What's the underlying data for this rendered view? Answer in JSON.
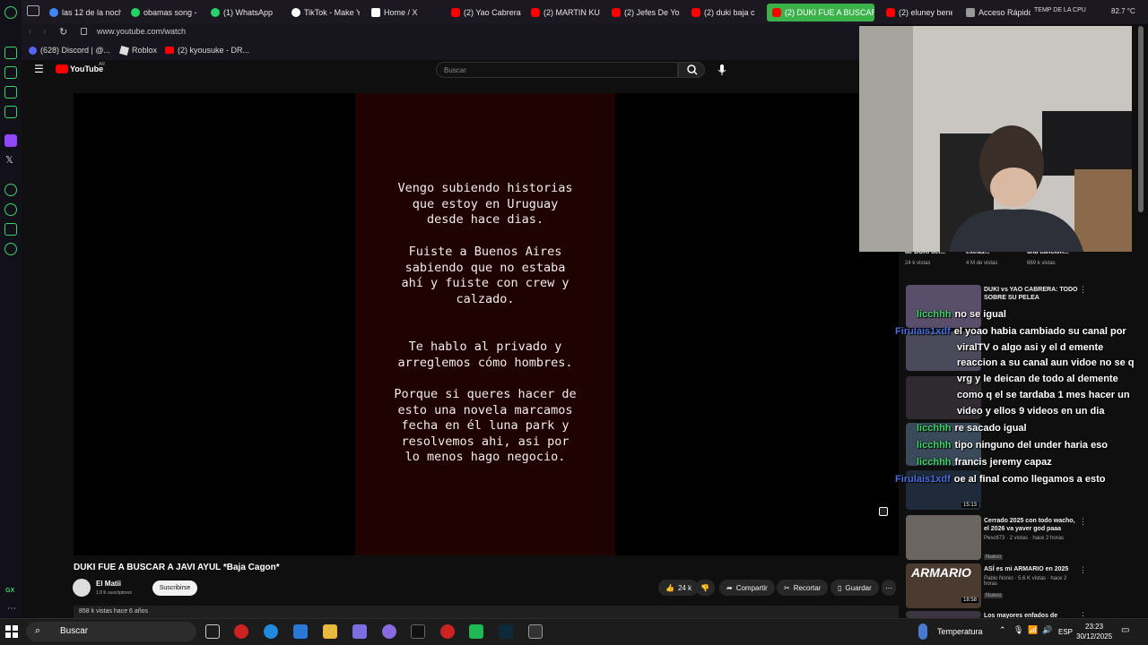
{
  "browser": {
    "tabs": [
      {
        "label": "las 12 de la noch",
        "color": "#4285f4"
      },
      {
        "label": "obamas song -",
        "color": "#1ed760"
      },
      {
        "label": "(1) WhatsApp",
        "color": "#25d366"
      },
      {
        "label": "TikTok - Make Y",
        "color": "#ffffff"
      },
      {
        "label": "Home / X",
        "color": "#ffffff"
      },
      {
        "label": "(2) Yao Cabrera",
        "color": "#ff0000"
      },
      {
        "label": "(2) MARTIN KU",
        "color": "#ff0000"
      },
      {
        "label": "(2) Jefes De Yo",
        "color": "#ff0000"
      },
      {
        "label": "(2) duki baja c",
        "color": "#ff0000"
      },
      {
        "label": "(2) DUKI FUE A BUSCAR",
        "color": "#ff0000",
        "active": true
      },
      {
        "label": "(2) eluney bene",
        "color": "#ff0000"
      },
      {
        "label": "Acceso Rápido",
        "color": "#999999"
      }
    ],
    "hw_label": "TEMP DE LA CPU",
    "hw_value": "82.7 °C",
    "url": "www.youtube.com/watch",
    "bookmarks": [
      {
        "label": "(628) Discord | @...",
        "color": "#5865f2"
      },
      {
        "label": "Roblox",
        "color": "#dddddd"
      },
      {
        "label": "(2) kyousuke - DR...",
        "color": "#ff0000"
      }
    ],
    "gx_label": "GX"
  },
  "youtube": {
    "logo": "YouTube",
    "logo_region": "AR",
    "search_placeholder": "Buscar",
    "accent": "#ff0000"
  },
  "video": {
    "paragraphs": [
      "Vengo subiendo historias\nque estoy en Uruguay\ndesde hace dias.",
      "Fuiste a Buenos Aires\nsabiendo que no estaba\nahí y fuiste con crew y\ncalzado.",
      "Te hablo al privado y\narreglemos cómo hombres.",
      "Porque si queres hacer de\nesto una novela marcamos\nfecha en él luna park y\nresolvemos ahi, asi por\nlo menos hago negocio."
    ],
    "title": "DUKI FUE A BUSCAR A JAVI AYUL *Baja Cagon*",
    "channel": "El Matii",
    "subscribers": "1.8 K suscriptores",
    "subscribe_label": "Suscribirse",
    "likes": "24 k",
    "share_label": "Compartir",
    "clip_label": "Recortar",
    "save_label": "Guardar",
    "views": "858 k vistas  hace 6 años"
  },
  "sidebar": {
    "top_row": {
      "titles": [
        "de DUKI del...",
        "extras...",
        "una cancion..."
      ],
      "metas": [
        "24 k vistas",
        "4 M de vistas",
        "669 k vistas"
      ]
    },
    "items": [
      {
        "title": "DUKI vs YAO CABRERA: TODO SOBRE SU PELEA",
        "meta": ""
      },
      {
        "title": "Cerrado 2025 con todo wacho, el 2026 va yaver god paaa",
        "meta": "Pesc673 · 2 vistas · hace 2 horas",
        "badge": "Nuevo"
      },
      {
        "title": "ASÍ es mi ARMARIO en 2025",
        "meta": "Pablo Nonio · 5.6 K vistas · hace 2 horas",
        "badge": "Nuevo",
        "thumb_text": "ARMARIO"
      },
      {
        "title": "Los mayores enfados de robleis",
        "meta": ""
      }
    ],
    "durations": [
      "15:13",
      "18:58"
    ]
  },
  "chat": [
    {
      "user": "licchhh",
      "color": "#3fd46a",
      "msg": "no se igual"
    },
    {
      "user": "Firulais1xdf",
      "color": "#4a6ee0",
      "msg": "el yoao habia cambiado su canal por"
    },
    {
      "user": "",
      "color": "#ffffff",
      "msg": "viralTV o algo asi y el d emente"
    },
    {
      "user": "",
      "color": "#ffffff",
      "msg": "reaccion a su canal aun vidoe no se q"
    },
    {
      "user": "",
      "color": "#ffffff",
      "msg": "vrg y le deican de todo al demente"
    },
    {
      "user": "",
      "color": "#ffffff",
      "msg": "como q el se tardaba 1 mes hacer un"
    },
    {
      "user": "",
      "color": "#ffffff",
      "msg": "video y ellos 9 videos en un dia"
    },
    {
      "user": "licchhh",
      "color": "#3fd46a",
      "msg": "re sacado igual"
    },
    {
      "user": "licchhh",
      "color": "#3fd46a",
      "msg": "tipo ninguno del under haria eso"
    },
    {
      "user": "licchhh",
      "color": "#3fd46a",
      "msg": "francis jeremy capaz"
    },
    {
      "user": "Firulais1xdf",
      "color": "#4a6ee0",
      "msg": "oe al final como llegamos a esto"
    }
  ],
  "taskbar": {
    "search": "Buscar",
    "weather": "Temperatura",
    "lang": "ESP",
    "time": "23:23",
    "date": "30/12/2025"
  }
}
